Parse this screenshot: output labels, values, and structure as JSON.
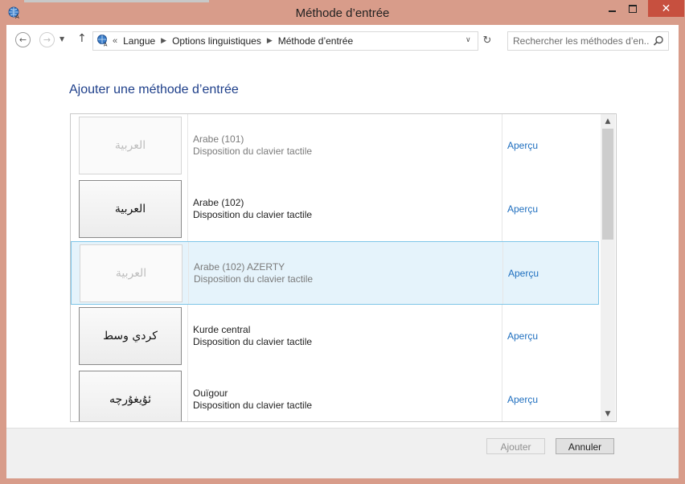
{
  "window": {
    "title": "Méthode d’entrée"
  },
  "titlebar_buttons": {
    "close_glyph": "✕"
  },
  "nav": {
    "back_glyph": "←",
    "forward_glyph": "→",
    "recent_glyph": "▼",
    "up_glyph": "↑"
  },
  "address": {
    "lead": "«",
    "crumbs": [
      "Langue",
      "Options linguistiques",
      "Méthode d’entrée"
    ],
    "sep_glyph": "▶",
    "dropdown_glyph": "∨",
    "refresh_glyph": "↻"
  },
  "search": {
    "placeholder": "Rechercher les méthodes d’en..."
  },
  "heading": "Ajouter une méthode d’entrée",
  "items": [
    {
      "thumb": "العربية",
      "name": "Arabe (101)",
      "desc": "Disposition du clavier tactile",
      "preview": "Aperçu",
      "state": "disabled"
    },
    {
      "thumb": "العربية",
      "name": "Arabe (102)",
      "desc": "Disposition du clavier tactile",
      "preview": "Aperçu",
      "state": "normal"
    },
    {
      "thumb": "العربية",
      "name": "Arabe (102) AZERTY",
      "desc": "Disposition du clavier tactile",
      "preview": "Aperçu",
      "state": "selected-disabled"
    },
    {
      "thumb": "كردي وسط",
      "name": "Kurde central",
      "desc": "Disposition du clavier tactile",
      "preview": "Aperçu",
      "state": "normal"
    },
    {
      "thumb": "ئۇيغۇرچە",
      "name": "Ouïgour",
      "desc": "Disposition du clavier tactile",
      "preview": "Aperçu",
      "state": "normal"
    }
  ],
  "scrollbar": {
    "up_glyph": "▲",
    "down_glyph": "▼",
    "position": 0.0
  },
  "footer": {
    "add_label": "Ajouter",
    "cancel_label": "Annuler"
  },
  "colors": {
    "frame": "#d89c8a",
    "close": "#c7503f",
    "heading": "#1e3f8a",
    "link": "#1f6fbf",
    "selection": "#e5f3fb"
  }
}
